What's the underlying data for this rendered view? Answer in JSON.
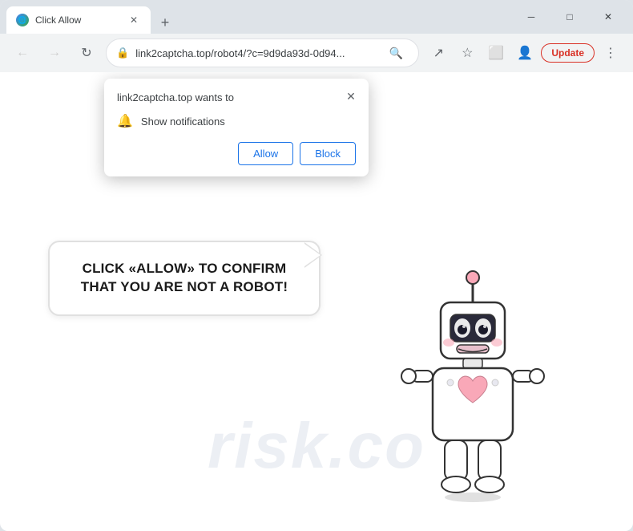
{
  "browser": {
    "title": "Click Allow",
    "tab": {
      "label": "Click Allow",
      "favicon": "🌐"
    },
    "window_controls": {
      "minimize": "─",
      "maximize": "□",
      "close": "✕"
    },
    "new_tab_icon": "+",
    "nav": {
      "back": "←",
      "forward": "→",
      "reload": "↻"
    },
    "address_bar": {
      "url": "link2captcha.top/robot4/?c=9d9da93d-0d94...",
      "lock": "🔒"
    },
    "toolbar_icons": {
      "search": "🔍",
      "share": "↗",
      "bookmark": "☆",
      "desktop": "⬜",
      "account": "👤",
      "more": "⋮"
    },
    "update_button": "Update"
  },
  "notification_popup": {
    "title": "link2captcha.top wants to",
    "notification_item": "Show notifications",
    "allow_button": "Allow",
    "block_button": "Block",
    "close_icon": "✕"
  },
  "page": {
    "watermark": "risk.co",
    "speech_bubble_text": "CLICK «ALLOW» TO CONFIRM THAT YOU ARE NOT A ROBOT!"
  }
}
